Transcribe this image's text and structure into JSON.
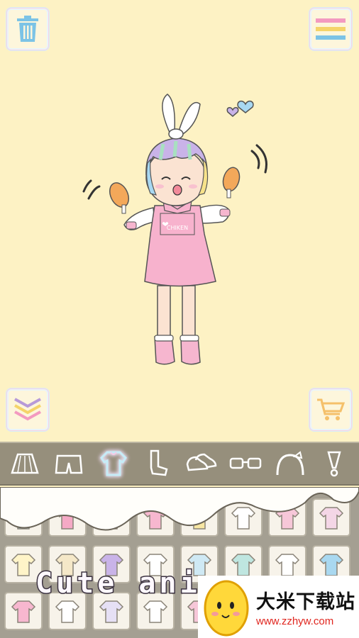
{
  "top_controls": {
    "trash_icon": "trash-icon",
    "menu_icon": "menu-icon"
  },
  "bottom_controls": {
    "collapse_icon": "chevron-down-icon",
    "shop_icon": "cart-icon"
  },
  "character": {
    "shirt_text": "CHIKEN"
  },
  "categories": [
    {
      "icon": "skirt-icon",
      "active": false
    },
    {
      "icon": "shorts-icon",
      "active": false
    },
    {
      "icon": "tops-icon",
      "active": true
    },
    {
      "icon": "socks-icon",
      "active": false
    },
    {
      "icon": "shoes-icon",
      "active": false
    },
    {
      "icon": "glasses-icon",
      "active": false
    },
    {
      "icon": "headband-icon",
      "active": false
    },
    {
      "icon": "accessory-icon",
      "active": false
    }
  ],
  "banner": {
    "text": "Cute ani"
  },
  "watermark": {
    "name": "大米下载站",
    "url": "www.zzhyw.com"
  },
  "colors": {
    "background": "#fdf2c4",
    "bar": "#968f7c",
    "grid": "#a49f92",
    "pink": "#f5a9c5",
    "blue": "#a9d8f0",
    "watermark_red": "#e0261f"
  }
}
